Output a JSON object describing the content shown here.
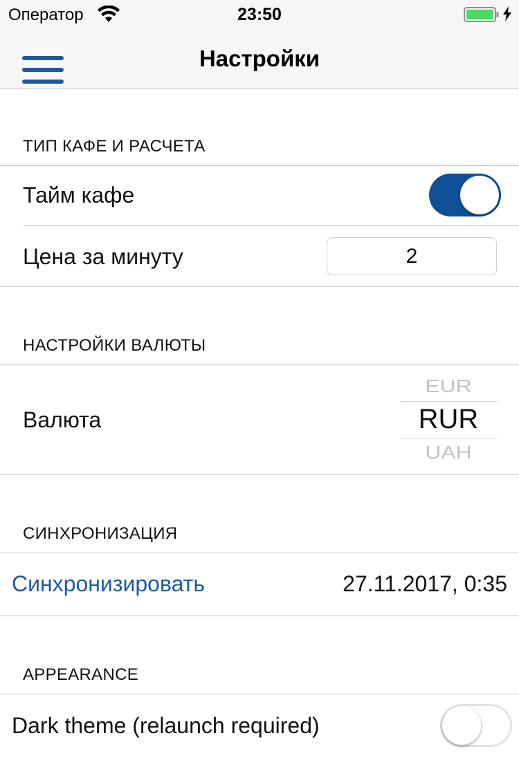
{
  "status_bar": {
    "carrier": "Оператор",
    "time": "23:50",
    "battery_color": "#4cd964"
  },
  "nav": {
    "title": "Настройки",
    "accent_color": "#1f5aa0"
  },
  "sections": {
    "cafe": {
      "header": "ТИП КАФЕ И РАСЧЕТА",
      "time_cafe_label": "Тайм кафе",
      "time_cafe_on": true,
      "price_label": "Цена за минуту",
      "price_value": "2"
    },
    "currency": {
      "header": "НАСТРОЙКИ ВАЛЮТЫ",
      "label": "Валюта",
      "options": [
        "EUR",
        "RUR",
        "UAH"
      ],
      "selected": "RUR"
    },
    "sync": {
      "header": "СИНХРОНИЗАЦИЯ",
      "button_label": "Синхронизировать",
      "last_sync": "27.11.2017, 0:35"
    },
    "appearance": {
      "header": "APPEARANCE",
      "dark_theme_label": "Dark theme (relaunch required)",
      "dark_theme_on": false
    }
  },
  "colors": {
    "toggle_on": "#0f4f96",
    "link": "#1f5aa0",
    "separator": "#c8c8cc"
  }
}
